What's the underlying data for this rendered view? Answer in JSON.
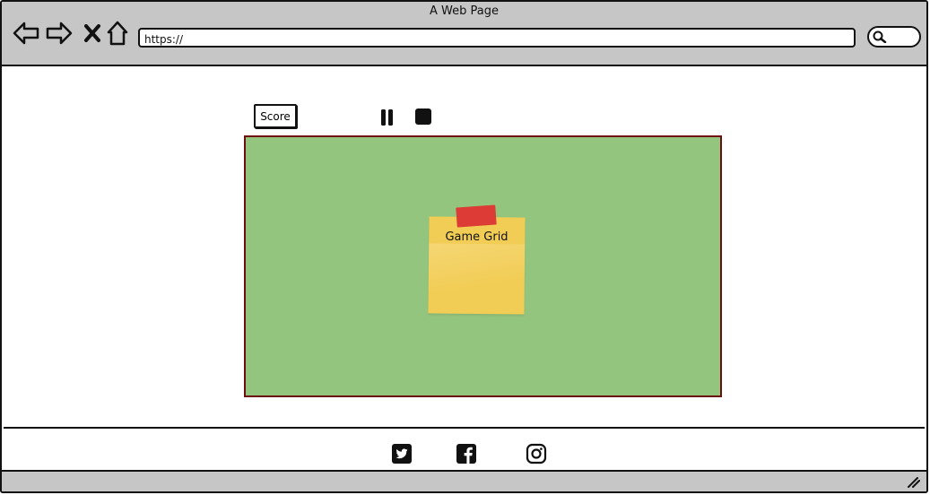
{
  "window": {
    "title": "A Web Page"
  },
  "toolbar": {
    "back_icon": "back-arrow-icon",
    "forward_icon": "forward-arrow-icon",
    "stop_icon": "close-icon",
    "home_icon": "home-icon",
    "url_value": "https://",
    "search_icon": "search-icon"
  },
  "game": {
    "score_label": "Score",
    "pause_icon": "pause-icon",
    "stop_icon": "stop-icon",
    "grid_label": "Game Grid",
    "grid_color": "#94c57e",
    "grid_border_color": "#6b0f0f",
    "note_color": "#f2cd55",
    "tape_color": "#dc3c35"
  },
  "footer": {
    "social": [
      {
        "icon": "twitter-icon"
      },
      {
        "icon": "facebook-icon"
      },
      {
        "icon": "instagram-icon"
      }
    ]
  }
}
